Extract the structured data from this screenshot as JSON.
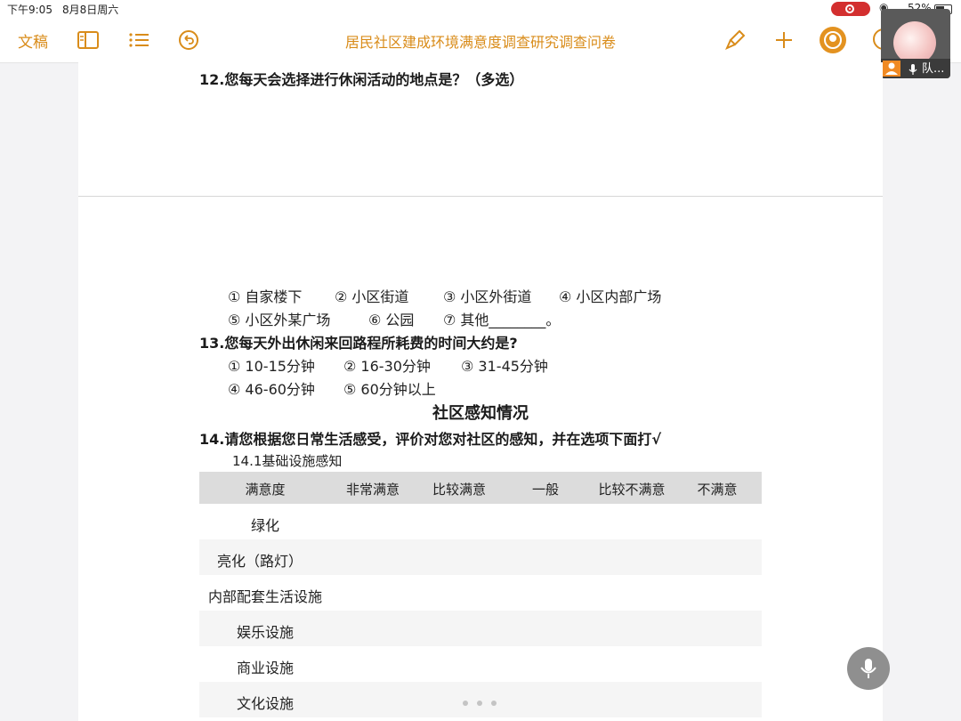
{
  "status_bar": {
    "time": "下午9:05",
    "date": "8月8日周六",
    "battery": "52%"
  },
  "toolbar": {
    "back_label": "文稿",
    "title": "居民社区建成环境满意度调查研究调查问卷"
  },
  "video_call": {
    "name": "队..."
  },
  "questions": {
    "q12": "12.您每天会选择进行休闲活动的地点是？（多选）",
    "q12_options": [
      "① 自家楼下",
      "② 小区街道",
      "③ 小区外街道",
      "④ 小区内部广场",
      "⑤ 小区外某广场",
      "⑥ 公园",
      "⑦ 其他________。"
    ],
    "q13": "13.您每天外出休闲来回路程所耗费的时间大约是?",
    "q13_options": [
      "① 10-15分钟",
      "② 16-30分钟",
      "③ 31-45分钟",
      "④ 46-60分钟",
      "⑤ 60分钟以上"
    ],
    "section": "社区感知情况",
    "q14": "14.请您根据您日常生活感受，评价对您对社区的感知，并在选项下面打√",
    "q14_1": "14.1基础设施感知"
  },
  "table": {
    "headers": [
      "满意度",
      "非常满意",
      "比较满意",
      "一般",
      "比较不满意",
      "不满意"
    ],
    "rows": [
      "绿化",
      "亮化（路灯）",
      "内部配套生活设施",
      "娱乐设施",
      "商业设施",
      "文化设施"
    ]
  },
  "colors": {
    "accent": "#d98c1a",
    "recording": "#d32f2f"
  }
}
